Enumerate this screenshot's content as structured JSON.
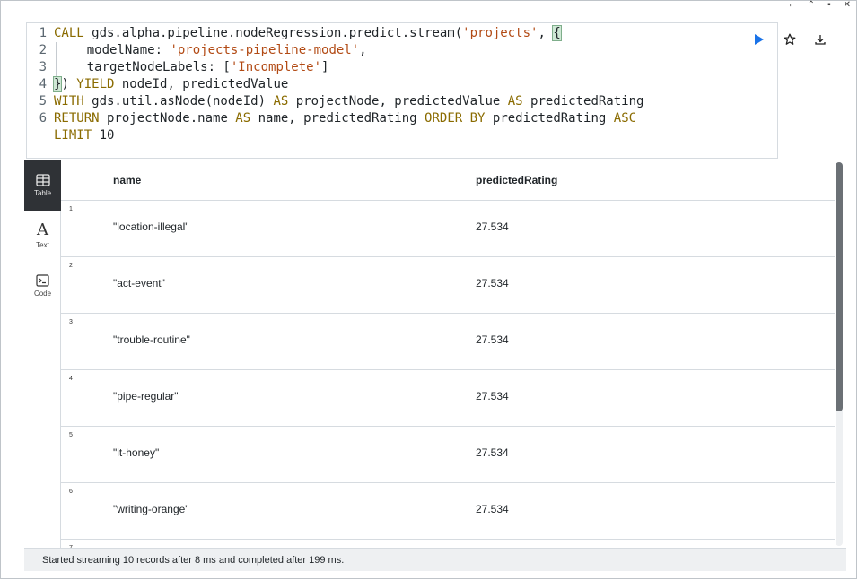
{
  "editor": {
    "lines": [
      {
        "num": "1"
      },
      {
        "num": "2"
      },
      {
        "num": "3"
      },
      {
        "num": "4"
      },
      {
        "num": "5"
      },
      {
        "num": "6"
      }
    ],
    "tokens": {
      "l1_call": "CALL",
      "l1_proc": " gds.alpha.pipeline.nodeRegression.predict.stream(",
      "l1_str": "'projects'",
      "l1_comma": ", ",
      "l1_brace": "{",
      "l2_key": "    modelName: ",
      "l2_str": "'projects-pipeline-model'",
      "l2_comma": ",",
      "l3_key": "    targetNodeLabels: [",
      "l3_str": "'Incomplete'",
      "l3_end": "]",
      "l4_brace": "}",
      "l4_paren": ") ",
      "l4_yield": "YIELD",
      "l4_rest": " nodeId, predictedValue",
      "l5_with": "WITH",
      "l5_mid": " gds.util.asNode(nodeId) ",
      "l5_as1": "AS",
      "l5_mid2": " projectNode, predictedValue ",
      "l5_as2": "AS",
      "l5_end": " predictedRating",
      "l6_return": "RETURN",
      "l6_mid": " projectNode.name ",
      "l6_as": "AS",
      "l6_mid2": " name, predictedRating ",
      "l6_order": "ORDER BY",
      "l6_mid3": " predictedRating ",
      "l6_asc": "ASC",
      "l7_limit": "LIMIT",
      "l7_num": " 10"
    },
    "actions": {
      "run_icon": "play-icon",
      "favorite_icon": "star-icon",
      "download_icon": "download-icon"
    }
  },
  "sidebar": {
    "items": [
      {
        "label": "Table",
        "icon": "table-icon"
      },
      {
        "label": "Text",
        "icon": "text-icon"
      },
      {
        "label": "Code",
        "icon": "code-icon"
      }
    ]
  },
  "table": {
    "columns": [
      "name",
      "predictedRating"
    ],
    "rows": [
      {
        "num": "1",
        "name": "\"location-illegal\"",
        "rating": "27.534"
      },
      {
        "num": "2",
        "name": "\"act-event\"",
        "rating": "27.534"
      },
      {
        "num": "3",
        "name": "\"trouble-routine\"",
        "rating": "27.534"
      },
      {
        "num": "4",
        "name": "\"pipe-regular\"",
        "rating": "27.534"
      },
      {
        "num": "5",
        "name": "\"it-honey\"",
        "rating": "27.534"
      },
      {
        "num": "6",
        "name": "\"writing-orange\"",
        "rating": "27.534"
      },
      {
        "num": "7",
        "name": "",
        "rating": ""
      }
    ]
  },
  "status": {
    "text": "Started streaming 10 records after 8 ms and completed after 199 ms."
  },
  "colors": {
    "run_blue": "#1a73e8",
    "keyword": "#8a6b00",
    "string": "#b24a14",
    "sidebar_active": "#2f3236"
  }
}
